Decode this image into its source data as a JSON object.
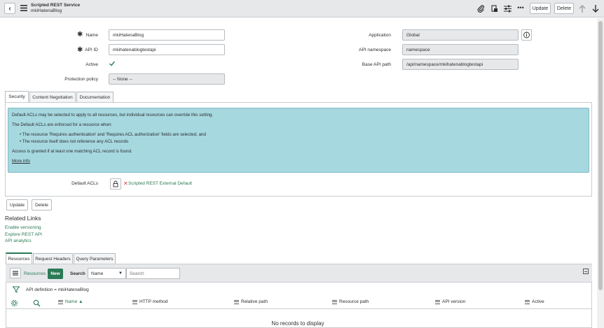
{
  "header": {
    "title": "Scripted REST Service",
    "subtitle": "mkiHatenaBlog",
    "update_label": "Update",
    "delete_label": "Delete"
  },
  "form": {
    "name_label": "Name",
    "name_value": "mkiHatenaBlog",
    "api_id_label": "API ID",
    "api_id_value": "mkihatenablogtestapi",
    "active_label": "Active",
    "protection_label": "Protection policy",
    "protection_value": "-- None --",
    "application_label": "Application",
    "application_value": "Global",
    "namespace_label": "API namespace",
    "namespace_value": "namespace",
    "base_path_label": "Base API path",
    "base_path_value": "/api/namespace/mkihatenablogtestapi"
  },
  "tabs": [
    "Security",
    "Content Negotiation",
    "Documentation"
  ],
  "info": {
    "line1": "Default ACLs may be selected to apply to all resources, but individual resources can override this setting.",
    "line2": "The Default ACLs are enforced for a resource when:",
    "bullet1": "The resource 'Requires authentication' and 'Requires ACL authorization' fields are selected, and",
    "bullet2": "The resource itself does not reference any ACL records",
    "line3": "Access is granted if at least one matching ACL record is found.",
    "more": "More info"
  },
  "acl": {
    "label": "Default ACLs",
    "value": "Scripted REST External Default"
  },
  "buttons": {
    "update": "Update",
    "delete": "Delete"
  },
  "related": {
    "title": "Related Links",
    "links": [
      "Enable versioning",
      "Explore REST API",
      "API analytics"
    ]
  },
  "list_tabs": [
    "Resources",
    "Request Headers",
    "Query Parameters"
  ],
  "list": {
    "title": "Resources",
    "new_label": "New",
    "search_label": "Search",
    "search_field": "Name",
    "search_placeholder": "Search",
    "filter": "API definition = mkiHatenaBlog",
    "columns": [
      "Name ▲",
      "HTTP method",
      "Relative path",
      "Resource path",
      "API version",
      "Active"
    ],
    "empty": "No records to display"
  }
}
